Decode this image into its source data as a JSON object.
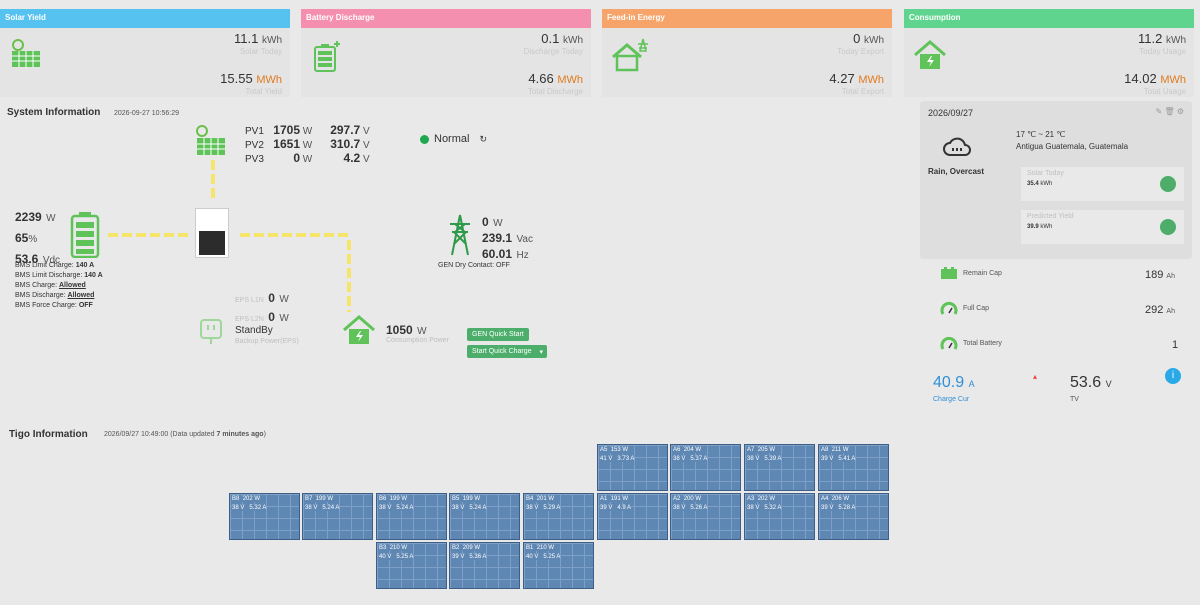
{
  "colors": {
    "solar": "#56c2f0",
    "battery": "#f58fb0",
    "grid": "#f6a46a",
    "consumption": "#5fd48f",
    "accent_green": "#4cae6a",
    "charge_blue": "#2f8fd8"
  },
  "cards": [
    {
      "title": "Solar Yield",
      "today_value": "11.1",
      "today_unit": "kWh",
      "today_label": "Solar Today",
      "total_value": "15.55",
      "total_unit": "MWh",
      "total_label": "Total Yield",
      "icon": "solar-panel-icon"
    },
    {
      "title": "Battery Discharge",
      "today_value": "0.1",
      "today_unit": "kWh",
      "today_label": "Discharge Today",
      "total_value": "4.66",
      "total_unit": "MWh",
      "total_label": "Total Discharge",
      "icon": "battery-icon"
    },
    {
      "title": "Feed-in Energy",
      "today_value": "0",
      "today_unit": "kWh",
      "today_label": "Today Export",
      "total_value": "4.27",
      "total_unit": "MWh",
      "total_label": "Total Export",
      "icon": "grid-house-icon"
    },
    {
      "title": "Consumption",
      "today_value": "11.2",
      "today_unit": "kWh",
      "today_label": "Today Usage",
      "total_value": "14.02",
      "total_unit": "MWh",
      "total_label": "Total Usage",
      "icon": "house-icon"
    }
  ],
  "system": {
    "title": "System Information",
    "timestamp": "2026-09-27 10:56:29",
    "pv": [
      {
        "label": "PV1",
        "power": "1705",
        "power_unit": "W",
        "voltage": "297.7",
        "voltage_unit": "V"
      },
      {
        "label": "PV2",
        "power": "1651",
        "power_unit": "W",
        "voltage": "310.7",
        "voltage_unit": "V"
      },
      {
        "label": "PV3",
        "power": "0",
        "power_unit": "W",
        "voltage": "4.2",
        "voltage_unit": "V"
      }
    ],
    "status": "Normal",
    "battery": {
      "power": "2239",
      "power_unit": "W",
      "soc": "65",
      "soc_unit": "%",
      "voltage": "53.6",
      "voltage_unit": "Vdc",
      "bms_limit_charge_label": "BMS Limit Charge:",
      "bms_limit_charge": "140 A",
      "bms_limit_discharge_label": "BMS Limit Discharge:",
      "bms_limit_discharge": "140 A",
      "bms_charge_label": "BMS Charge:",
      "bms_charge": "Allowed",
      "bms_discharge_label": "BMS Discharge:",
      "bms_discharge": "Allowed",
      "bms_force_label": "BMS Force Charge:",
      "bms_force": "OFF"
    },
    "grid": {
      "power": "0",
      "power_unit": "W",
      "voltage": "239.1",
      "voltage_unit": "Vac",
      "freq": "60.01",
      "freq_unit": "Hz",
      "gen_dry": "GEN Dry Contact: OFF"
    },
    "eps": {
      "l1n_label": "EPS L1N",
      "l1n": "0",
      "l1n_unit": "W",
      "l2n_label": "EPS L2N",
      "l2n": "0",
      "l2n_unit": "W",
      "status": "StandBy",
      "sub": "Backup Power(EPS)"
    },
    "consumption": {
      "power": "1050",
      "power_unit": "W",
      "label": "Consumption Power"
    },
    "buttons": {
      "gen_quick_start": "GEN Quick Start",
      "start_quick_charge": "Start Quick Charge"
    }
  },
  "weather": {
    "date": "2026/09/27",
    "temp": "17 ℃ ~ 21 ℃",
    "location": "Antigua Guatemala, Guatemala",
    "condition": "Rain, Overcast",
    "box1_label": "Solar Today",
    "box1_value": "35.4",
    "box1_unit": "kWh",
    "box2_label": "Predicted Yield",
    "box2_value": "39.9",
    "box2_unit": "kWh"
  },
  "battery_stats": {
    "remain_label": "Remain Cap",
    "remain_value": "189",
    "remain_unit": "Ah",
    "full_label": "Full Cap",
    "full_value": "292",
    "full_unit": "Ah",
    "total_label": "Total Battery",
    "total_value": "1",
    "charge_cur": "40.9",
    "charge_cur_unit": "A",
    "charge_cur_label": "Charge Cur",
    "tv": "53.6",
    "tv_unit": "V",
    "tv_label": "TV"
  },
  "tigo": {
    "title": "Tigo Information",
    "timestamp": "2026/09/27 10:49:00",
    "data_prefix": "(Data updated ",
    "data_bold": "7 minutes ago",
    "data_suffix": ")",
    "row_a_top": [
      {
        "id": "A5",
        "power": "153 W",
        "volt": "41 V",
        "cur": "3.73 A"
      },
      {
        "id": "A6",
        "power": "204 W",
        "volt": "38 V",
        "cur": "5.37 A"
      },
      {
        "id": "A7",
        "power": "205 W",
        "volt": "38 V",
        "cur": "5.39 A"
      },
      {
        "id": "A8",
        "power": "211 W",
        "volt": "39 V",
        "cur": "5.41 A"
      }
    ],
    "row_mid": [
      {
        "id": "B8",
        "power": "202 W",
        "volt": "38 V",
        "cur": "5.32 A"
      },
      {
        "id": "B7",
        "power": "199 W",
        "volt": "38 V",
        "cur": "5.24 A"
      },
      {
        "id": "B6",
        "power": "199 W",
        "volt": "38 V",
        "cur": "5.24 A"
      },
      {
        "id": "B5",
        "power": "199 W",
        "volt": "38 V",
        "cur": "5.24 A"
      },
      {
        "id": "B4",
        "power": "201 W",
        "volt": "38 V",
        "cur": "5.29 A"
      },
      {
        "id": "A1",
        "power": "191 W",
        "volt": "39 V",
        "cur": "4.9 A"
      },
      {
        "id": "A2",
        "power": "200 W",
        "volt": "38 V",
        "cur": "5.26 A"
      },
      {
        "id": "A3",
        "power": "202 W",
        "volt": "38 V",
        "cur": "5.32 A"
      },
      {
        "id": "A4",
        "power": "206 W",
        "volt": "39 V",
        "cur": "5.28 A"
      }
    ],
    "row_bottom": [
      {
        "id": "B3",
        "power": "210 W",
        "volt": "40 V",
        "cur": "5.25 A"
      },
      {
        "id": "B2",
        "power": "209 W",
        "volt": "39 V",
        "cur": "5.36 A"
      },
      {
        "id": "B1",
        "power": "210 W",
        "volt": "40 V",
        "cur": "5.25 A"
      }
    ]
  }
}
